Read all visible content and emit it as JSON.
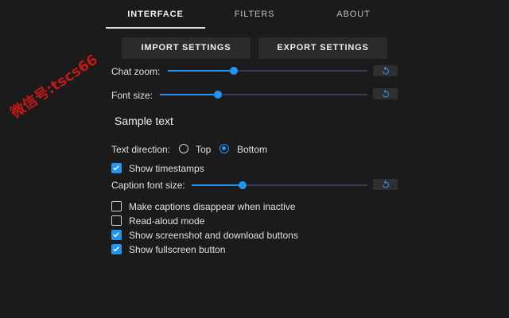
{
  "tabs": [
    {
      "label": "INTERFACE",
      "active": true
    },
    {
      "label": "FILTERS",
      "active": false
    },
    {
      "label": "ABOUT",
      "active": false
    }
  ],
  "buttons": {
    "import_label": "IMPORT SETTINGS",
    "export_label": "EXPORT SETTINGS"
  },
  "settings": {
    "chat_zoom": {
      "label": "Chat zoom:",
      "value_fraction": 0.33
    },
    "font_size": {
      "label": "Font size:",
      "value_fraction": 0.28
    },
    "sample_text": "Sample text",
    "text_direction": {
      "label": "Text direction:",
      "options": [
        "Top",
        "Bottom"
      ],
      "selected": "Bottom"
    },
    "show_timestamps": {
      "label": "Show timestamps",
      "checked": true
    },
    "caption_font_size": {
      "label": "Caption font size:",
      "value_fraction": 0.29
    },
    "make_captions_disappear": {
      "label": "Make captions disappear when inactive",
      "checked": false
    },
    "read_aloud": {
      "label": "Read-aloud mode",
      "checked": false
    },
    "show_screenshot_buttons": {
      "label": "Show screenshot and download buttons",
      "checked": true
    },
    "show_fullscreen": {
      "label": "Show fullscreen button",
      "checked": true
    }
  },
  "watermark": "微信号:tscs66",
  "colors": {
    "accent": "#2196f3",
    "background": "#1b1b1b",
    "button": "#2b2b2b"
  },
  "icons": {
    "reset": "reset-icon",
    "check": "check-icon"
  }
}
